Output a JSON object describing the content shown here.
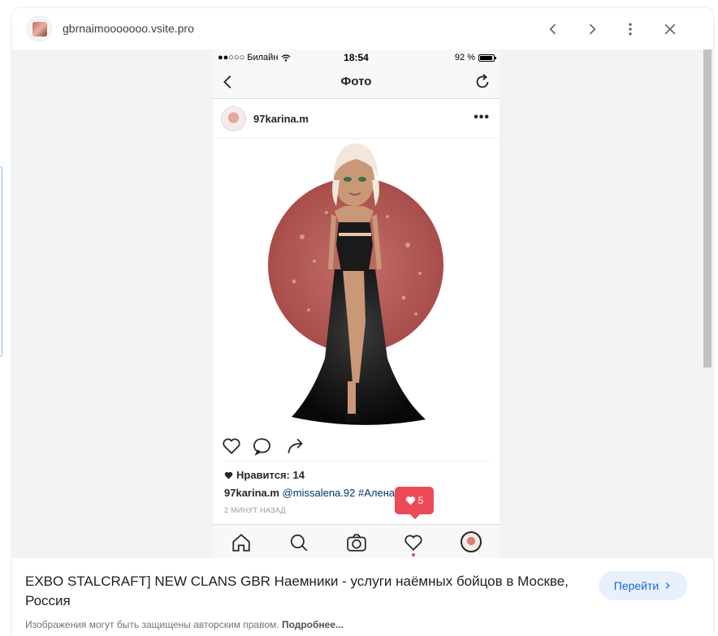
{
  "colors": {
    "accent": "#1967d2",
    "button_bg": "#e8f0fe",
    "viewer_bg": "#f1f3f4",
    "notification_red": "#ed4956"
  },
  "topbar": {
    "domain": "gbrnaimooooooo.vsite.pro",
    "icons": [
      "chevron-left-icon",
      "chevron-right-icon",
      "more-vert-icon",
      "close-icon"
    ]
  },
  "phone": {
    "status": {
      "carrier": "●●○○○ Билайн",
      "time": "18:54",
      "battery": "92 %",
      "battery_level": 0.92
    },
    "nav": {
      "title": "Фото"
    },
    "post": {
      "username": "97karina.m",
      "more": "•••",
      "likes": "Нравится: 14",
      "caption_user": "97karina.m",
      "caption_mention": "@missalena.92",
      "caption_tag": "#Аленаглазова",
      "time_ago": "2 МИНУТ НАЗАД"
    },
    "notification": {
      "count": "5"
    }
  },
  "footer": {
    "title": "EXBO STALCRAFT] NEW CLANS GBR Наемники - услуги наёмных бойцов в Москве, Россия",
    "go_button": "Перейти",
    "copyright": "Изображения могут быть защищены авторским правом.",
    "more_link": "Подробнее..."
  }
}
